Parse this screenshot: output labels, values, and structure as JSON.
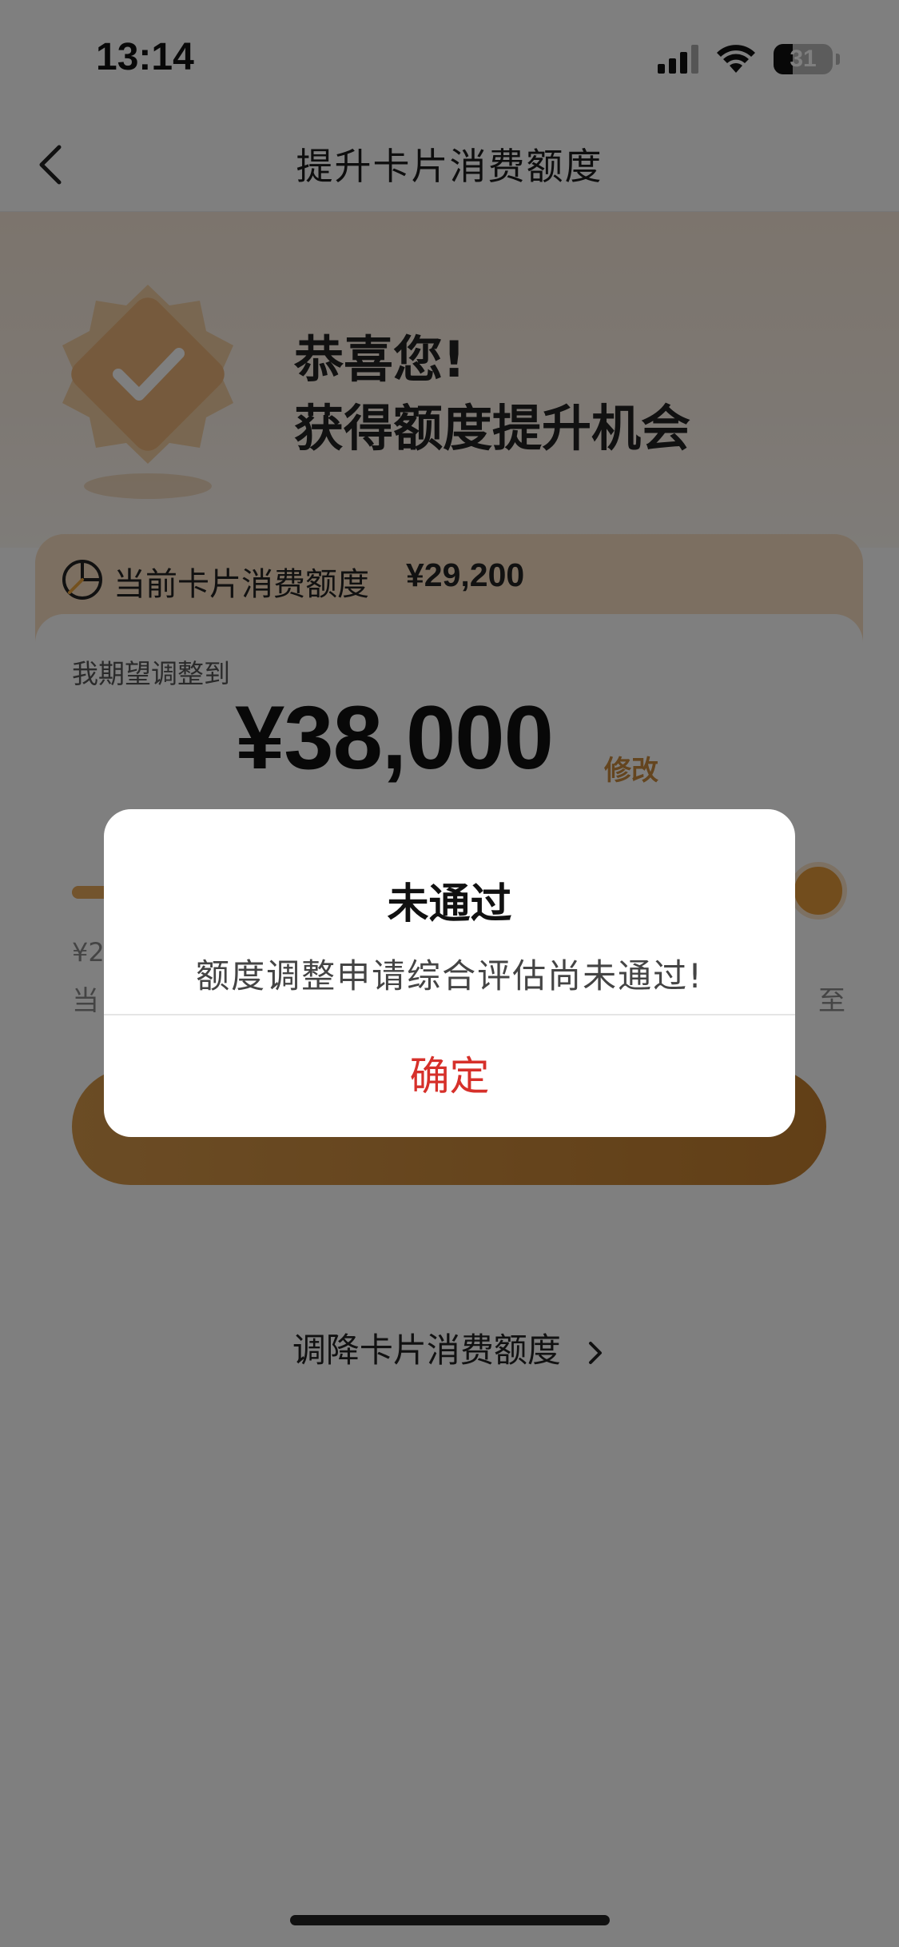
{
  "status_bar": {
    "time": "13:14",
    "battery": "31"
  },
  "nav": {
    "title": "提升卡片消费额度"
  },
  "hero": {
    "line1": "恭喜您!",
    "line2": "获得额度提升机会"
  },
  "card": {
    "current_label": "当前卡片消费额度",
    "current_value": "¥29,200",
    "expect_label": "我期望调整到",
    "amount": "¥38,000",
    "modify": "修改",
    "slider_fraction": 1.0,
    "min_value_visible": "¥2",
    "desc_left_visible": "当",
    "desc_right_visible": "至",
    "submit_visible": "",
    "decrease_link": "调降卡片消费额度"
  },
  "dialog": {
    "title": "未通过",
    "message": "额度调整申请综合评估尚未通过!",
    "confirm": "确定"
  },
  "colors": {
    "accent": "#c88a3e",
    "confirm": "#d6302a",
    "card_head": "#f9dfc2"
  }
}
